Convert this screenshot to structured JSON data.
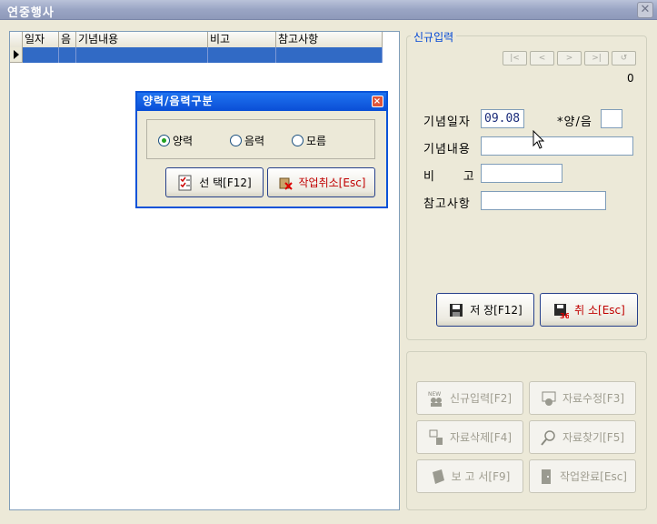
{
  "window": {
    "title": "연중행사",
    "close_glyph": "✕"
  },
  "grid": {
    "columns": [
      "일자",
      "음",
      "기념내용",
      "비고",
      "참고사항"
    ]
  },
  "entry": {
    "legend": "신규입력",
    "counter": "0",
    "nav_buttons": [
      "|<",
      "<",
      ">",
      ">|",
      "↺"
    ],
    "labels": {
      "date": "기념일자",
      "lunar": "*양/음",
      "content": "기념내용",
      "remark": "비      고",
      "reference": "참고사항"
    },
    "values": {
      "date": "09.08",
      "lunar": "",
      "content": "",
      "remark": "",
      "reference": ""
    },
    "save_label": "저 장[F12]",
    "cancel_label": "취 소[Esc]"
  },
  "actions": {
    "new_label": "신규입력[F2]",
    "edit_label": "자료수정[F3]",
    "delete_label": "자료삭제[F4]",
    "find_label": "자료찾기[F5]",
    "report_label": "보 고 서[F9]",
    "done_label": "작업완료[Esc]"
  },
  "dialog": {
    "title": "양력/음력구분",
    "close_glyph": "×",
    "options": [
      "양력",
      "음력",
      "모름"
    ],
    "selected": "양력",
    "select_label": "선 택[F12]",
    "cancel_label": "작업취소[Esc]"
  }
}
